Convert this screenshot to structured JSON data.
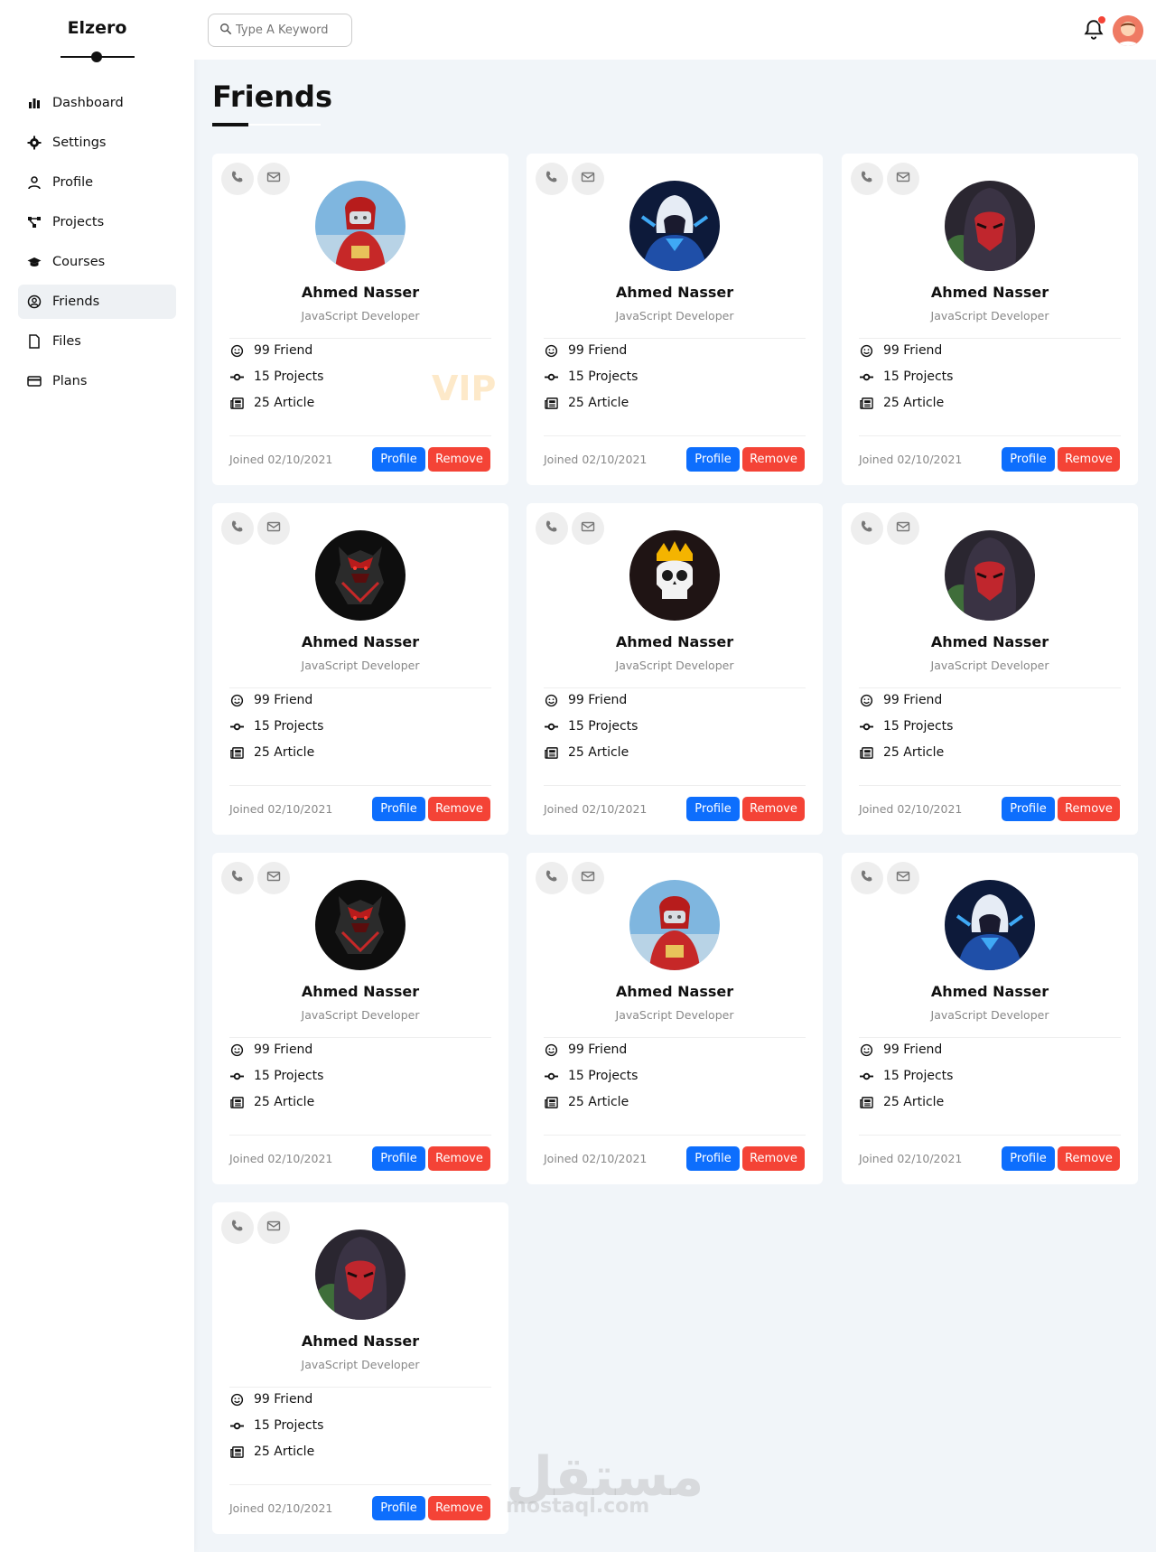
{
  "brand": "Elzero",
  "nav": [
    {
      "label": "Dashboard",
      "icon": "chart-bar-icon",
      "active": false
    },
    {
      "label": "Settings",
      "icon": "gear-icon",
      "active": false
    },
    {
      "label": "Profile",
      "icon": "user-icon",
      "active": false
    },
    {
      "label": "Projects",
      "icon": "diagram-project-icon",
      "active": false
    },
    {
      "label": "Courses",
      "icon": "graduation-cap-icon",
      "active": false
    },
    {
      "label": "Friends",
      "icon": "user-circle-icon",
      "active": true
    },
    {
      "label": "Files",
      "icon": "file-icon",
      "active": false
    },
    {
      "label": "Plans",
      "icon": "credit-card-icon",
      "active": false
    }
  ],
  "search": {
    "placeholder": "Type A Keyword"
  },
  "page_title": "Friends",
  "colors": {
    "primary": "#0d6efd",
    "danger": "#f44336",
    "background": "#f1f5f9"
  },
  "friends": [
    {
      "name": "Ahmed Nasser",
      "job": "JavaScript Developer",
      "friends": "99 Friend",
      "projects": "15 Projects",
      "articles": "25 Article",
      "joined": "Joined 02/10/2021",
      "profile": "Profile",
      "remove": "Remove",
      "avatar": "red-robot-avatar",
      "vip": "VIP"
    },
    {
      "name": "Ahmed Nasser",
      "job": "JavaScript Developer",
      "friends": "99 Friend",
      "projects": "15 Projects",
      "articles": "25 Article",
      "joined": "Joined 02/10/2021",
      "profile": "Profile",
      "remove": "Remove",
      "avatar": "blue-hooded-avatar"
    },
    {
      "name": "Ahmed Nasser",
      "job": "JavaScript Developer",
      "friends": "99 Friend",
      "projects": "15 Projects",
      "articles": "25 Article",
      "joined": "Joined 02/10/2021",
      "profile": "Profile",
      "remove": "Remove",
      "avatar": "red-mask-avatar"
    },
    {
      "name": "Ahmed Nasser",
      "job": "JavaScript Developer",
      "friends": "99 Friend",
      "projects": "15 Projects",
      "articles": "25 Article",
      "joined": "Joined 02/10/2021",
      "profile": "Profile",
      "remove": "Remove",
      "avatar": "dark-knight-avatar"
    },
    {
      "name": "Ahmed Nasser",
      "job": "JavaScript Developer",
      "friends": "99 Friend",
      "projects": "15 Projects",
      "articles": "25 Article",
      "joined": "Joined 02/10/2021",
      "profile": "Profile",
      "remove": "Remove",
      "avatar": "skull-crown-avatar"
    },
    {
      "name": "Ahmed Nasser",
      "job": "JavaScript Developer",
      "friends": "99 Friend",
      "projects": "15 Projects",
      "articles": "25 Article",
      "joined": "Joined 02/10/2021",
      "profile": "Profile",
      "remove": "Remove",
      "avatar": "red-mask-avatar"
    },
    {
      "name": "Ahmed Nasser",
      "job": "JavaScript Developer",
      "friends": "99 Friend",
      "projects": "15 Projects",
      "articles": "25 Article",
      "joined": "Joined 02/10/2021",
      "profile": "Profile",
      "remove": "Remove",
      "avatar": "dark-knight-avatar"
    },
    {
      "name": "Ahmed Nasser",
      "job": "JavaScript Developer",
      "friends": "99 Friend",
      "projects": "15 Projects",
      "articles": "25 Article",
      "joined": "Joined 02/10/2021",
      "profile": "Profile",
      "remove": "Remove",
      "avatar": "red-robot-avatar"
    },
    {
      "name": "Ahmed Nasser",
      "job": "JavaScript Developer",
      "friends": "99 Friend",
      "projects": "15 Projects",
      "articles": "25 Article",
      "joined": "Joined 02/10/2021",
      "profile": "Profile",
      "remove": "Remove",
      "avatar": "blue-hooded-avatar"
    },
    {
      "name": "Ahmed Nasser",
      "job": "JavaScript Developer",
      "friends": "99 Friend",
      "projects": "15 Projects",
      "articles": "25 Article",
      "joined": "Joined 02/10/2021",
      "profile": "Profile",
      "remove": "Remove",
      "avatar": "red-mask-avatar"
    }
  ],
  "watermark": {
    "arabic": "مستقل",
    "latin": "mostaql.com"
  }
}
